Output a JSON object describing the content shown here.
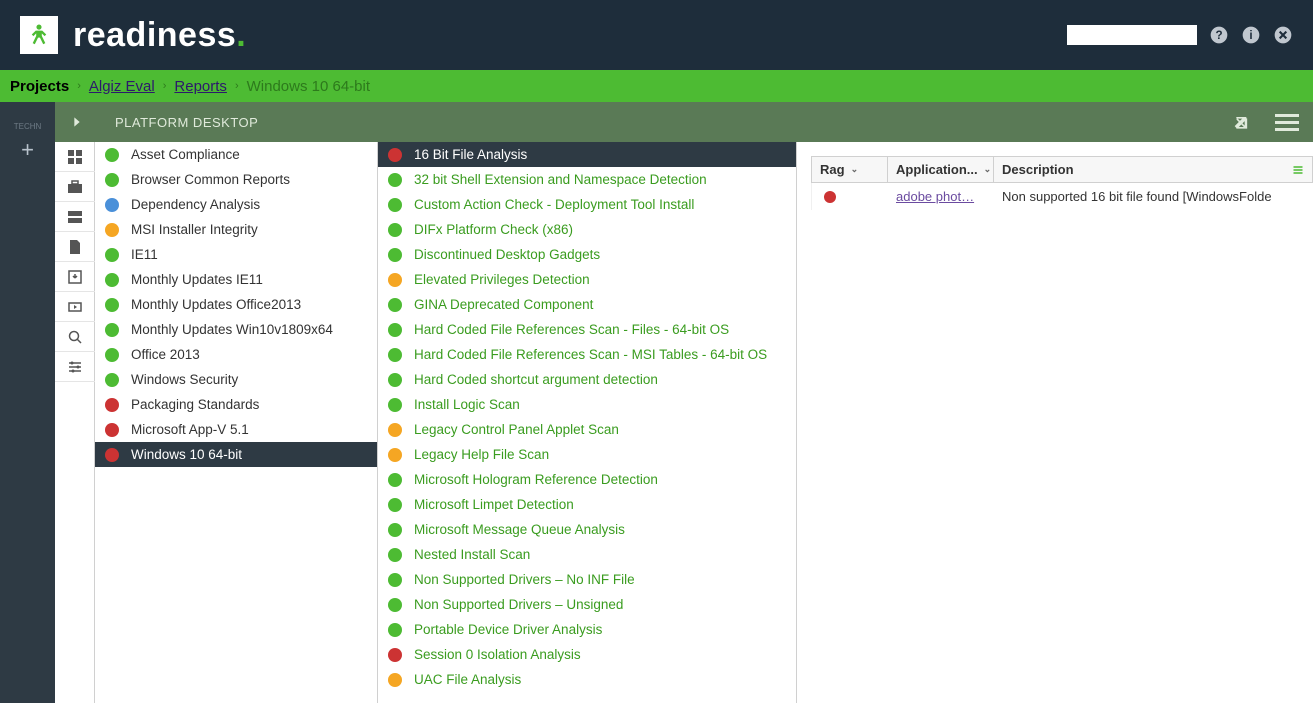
{
  "brand": "readiness",
  "breadcrumb": {
    "root": "Projects",
    "project": "Algiz Eval",
    "section": "Reports",
    "current": "Windows 10 64-bit"
  },
  "platform_bar": {
    "title": "PLATFORM DESKTOP"
  },
  "rail_label": "TECHN",
  "categories": [
    {
      "rag": "green",
      "label": "Asset Compliance",
      "selected": false
    },
    {
      "rag": "green",
      "label": "Browser Common Reports",
      "selected": false
    },
    {
      "rag": "blue",
      "label": "Dependency Analysis",
      "selected": false
    },
    {
      "rag": "amber",
      "label": "MSI Installer Integrity",
      "selected": false
    },
    {
      "rag": "green",
      "label": "IE11",
      "selected": false
    },
    {
      "rag": "green",
      "label": "Monthly Updates IE11",
      "selected": false
    },
    {
      "rag": "green",
      "label": "Monthly Updates Office2013",
      "selected": false
    },
    {
      "rag": "green",
      "label": "Monthly Updates Win10v1809x64",
      "selected": false
    },
    {
      "rag": "green",
      "label": "Office 2013",
      "selected": false
    },
    {
      "rag": "green",
      "label": "Windows Security",
      "selected": false
    },
    {
      "rag": "red",
      "label": "Packaging Standards",
      "selected": false
    },
    {
      "rag": "red",
      "label": "Microsoft App-V 5.1",
      "selected": false
    },
    {
      "rag": "red",
      "label": "Windows 10 64-bit",
      "selected": true
    }
  ],
  "checks": [
    {
      "rag": "red",
      "label": "16 Bit File Analysis",
      "selected": true
    },
    {
      "rag": "green",
      "label": "32 bit Shell Extension and Namespace Detection"
    },
    {
      "rag": "green",
      "label": "Custom Action Check - Deployment Tool Install"
    },
    {
      "rag": "green",
      "label": "DIFx Platform Check (x86)"
    },
    {
      "rag": "green",
      "label": "Discontinued Desktop Gadgets"
    },
    {
      "rag": "amber",
      "label": "Elevated Privileges Detection"
    },
    {
      "rag": "green",
      "label": "GINA Deprecated Component"
    },
    {
      "rag": "green",
      "label": "Hard Coded File References Scan - Files - 64-bit OS"
    },
    {
      "rag": "green",
      "label": "Hard Coded File References Scan - MSI Tables - 64-bit OS"
    },
    {
      "rag": "green",
      "label": "Hard Coded shortcut argument detection"
    },
    {
      "rag": "green",
      "label": "Install Logic Scan"
    },
    {
      "rag": "amber",
      "label": "Legacy Control Panel Applet Scan"
    },
    {
      "rag": "amber",
      "label": "Legacy Help File Scan"
    },
    {
      "rag": "green",
      "label": "Microsoft Hologram Reference Detection"
    },
    {
      "rag": "green",
      "label": "Microsoft Limpet Detection"
    },
    {
      "rag": "green",
      "label": "Microsoft Message Queue Analysis"
    },
    {
      "rag": "green",
      "label": "Nested Install Scan"
    },
    {
      "rag": "green",
      "label": "Non Supported Drivers – No INF File"
    },
    {
      "rag": "green",
      "label": "Non Supported Drivers – Unsigned"
    },
    {
      "rag": "green",
      "label": "Portable Device Driver Analysis"
    },
    {
      "rag": "red",
      "label": "Session 0 Isolation Analysis"
    },
    {
      "rag": "amber",
      "label": "UAC File Analysis"
    }
  ],
  "grid": {
    "headers": {
      "rag": "Rag",
      "app": "Application...",
      "desc": "Description"
    },
    "rows": [
      {
        "rag": "red",
        "app": "adobe phot…",
        "desc": "Non supported 16 bit file found [WindowsFolde"
      }
    ]
  }
}
